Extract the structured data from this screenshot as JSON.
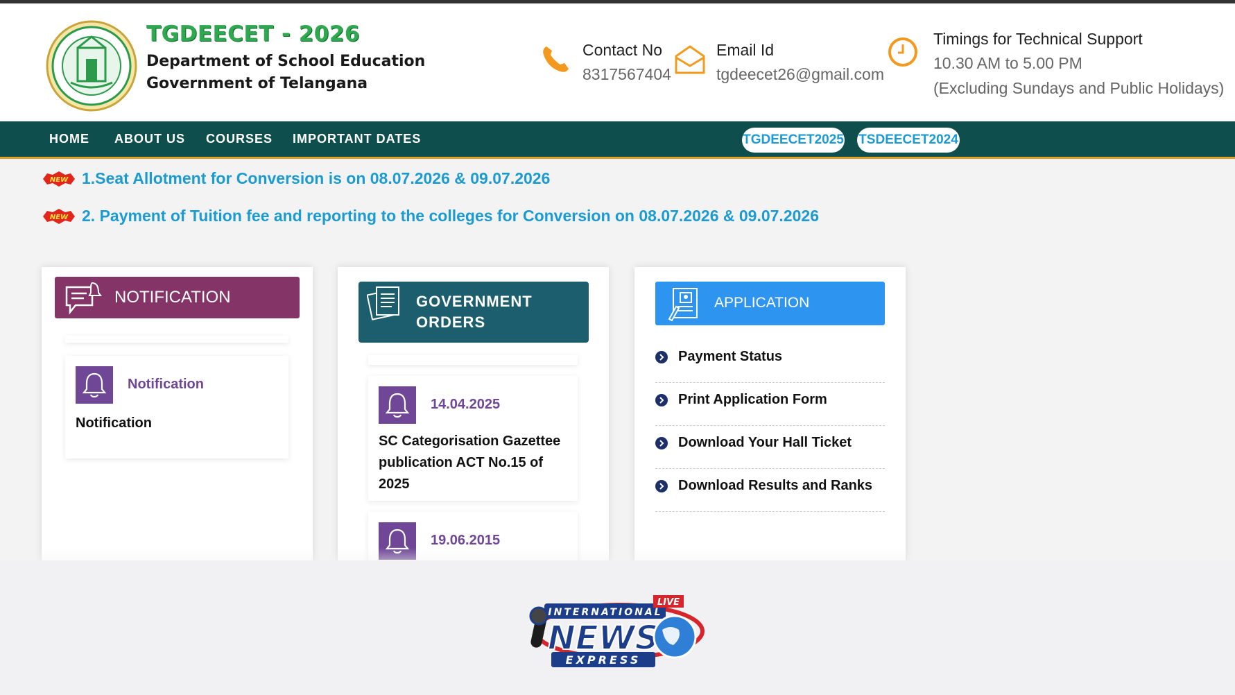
{
  "header": {
    "brand_title": "TGDEECET - 2026",
    "brand_line1": "Department of School Education",
    "brand_line2": "Government of Telangana",
    "contact_label": "Contact No",
    "contact_value": "8317567404",
    "email_label": "Email Id",
    "email_value": "tgdeecet26@gmail.com",
    "timing_label": "Timings for Technical Support",
    "timing_value": "10.30 AM to 5.00 PM",
    "timing_note": "(Excluding Sundays and Public Holidays)"
  },
  "nav": {
    "items": [
      "HOME",
      "ABOUT US",
      "COURSES",
      "IMPORTANT DATES"
    ],
    "pills": [
      "TGDEECET2025",
      "TSDEECET2024"
    ]
  },
  "news": {
    "badge": "NEW",
    "items": [
      "1.Seat Allotment for Conversion is on 08.07.2026 & 09.07.2026",
      "2. Payment of Tuition fee and reporting to the colleges for Conversion on 08.07.2026 & 09.07.2026"
    ]
  },
  "notification_card": {
    "title": "NOTIFICATION",
    "item_heading": "Notification",
    "item_text": "Notification"
  },
  "orders_card": {
    "title_line1": "GOVERNMENT",
    "title_line2": "ORDERS",
    "items": [
      {
        "date": "14.04.2025",
        "line1": "SC Categorisation Gazettee",
        "line2": "publication ACT No.15 of 2025"
      },
      {
        "date": "19.06.2015"
      }
    ]
  },
  "application_card": {
    "title": "APPLICATION",
    "items": [
      "Payment Status",
      "Print Application Form",
      "Download Your Hall Ticket",
      "Download Results and Ranks"
    ]
  },
  "watermark": {
    "line1": "INTERNATIONAL",
    "line2": "NEWS",
    "line3": "EXPRESS",
    "live": "LIVE"
  },
  "colors": {
    "nav_bg": "#0e4f4d",
    "accent_gold": "#e3a12a",
    "link_blue": "#1b9bd1",
    "notification_purple": "#843467",
    "orders_teal": "#1c5e6d",
    "application_blue": "#2d95f0",
    "bell_purple": "#6f4796"
  }
}
